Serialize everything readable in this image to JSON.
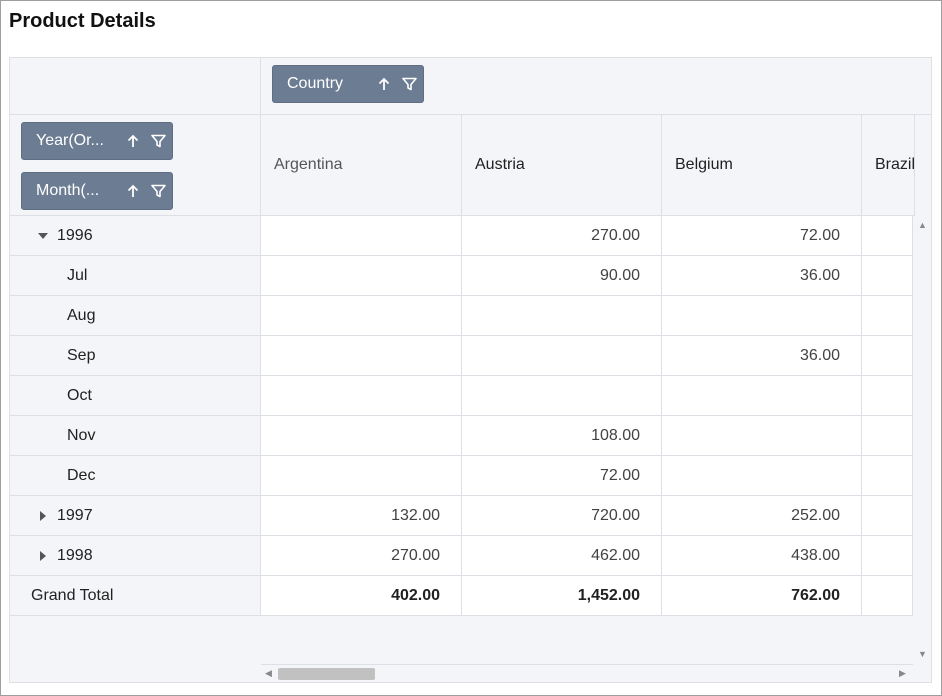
{
  "title": "Product Details",
  "column_field": {
    "label": "Country"
  },
  "row_fields": [
    {
      "label": "Year(Or..."
    },
    {
      "label": "Month(..."
    }
  ],
  "columns": [
    "Argentina",
    "Austria",
    "Belgium",
    "Brazil"
  ],
  "rows": [
    {
      "label": "1996",
      "level": 0,
      "expanded": true,
      "values": [
        "",
        "270.00",
        "72.00"
      ]
    },
    {
      "label": "Jul",
      "level": 1,
      "values": [
        "",
        "90.00",
        "36.00"
      ]
    },
    {
      "label": "Aug",
      "level": 1,
      "values": [
        "",
        "",
        ""
      ]
    },
    {
      "label": "Sep",
      "level": 1,
      "values": [
        "",
        "",
        "36.00"
      ]
    },
    {
      "label": "Oct",
      "level": 1,
      "values": [
        "",
        "",
        ""
      ]
    },
    {
      "label": "Nov",
      "level": 1,
      "values": [
        "",
        "108.00",
        ""
      ]
    },
    {
      "label": "Dec",
      "level": 1,
      "values": [
        "",
        "72.00",
        ""
      ]
    },
    {
      "label": "1997",
      "level": 0,
      "expanded": false,
      "values": [
        "132.00",
        "720.00",
        "252.00"
      ]
    },
    {
      "label": "1998",
      "level": 0,
      "expanded": false,
      "values": [
        "270.00",
        "462.00",
        "438.00"
      ]
    }
  ],
  "grand_total": {
    "label": "Grand Total",
    "values": [
      "402.00",
      "1,452.00",
      "762.00"
    ]
  },
  "colors": {
    "chip": "#6c7d93",
    "header_bg": "#f3f5f9",
    "border": "#dcdfe4"
  }
}
